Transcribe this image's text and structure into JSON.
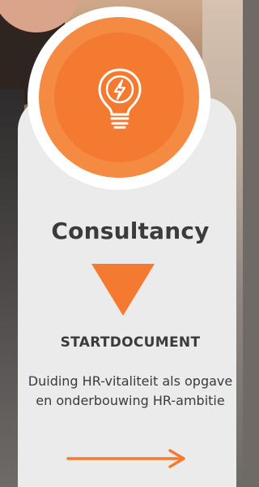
{
  "card": {
    "icon": "lightbulb-icon",
    "title": "Consultancy",
    "subtitle": "STARTDOCUMENT",
    "description": "Duiding HR-vitaliteit als opgave en onderbouwing HR-ambitie",
    "arrow_icon": "arrow-right-icon"
  },
  "colors": {
    "accent": "#f47a32",
    "accent_light": "#f58a42",
    "card_bg": "#ebebeb",
    "text": "#3b3b3b"
  }
}
